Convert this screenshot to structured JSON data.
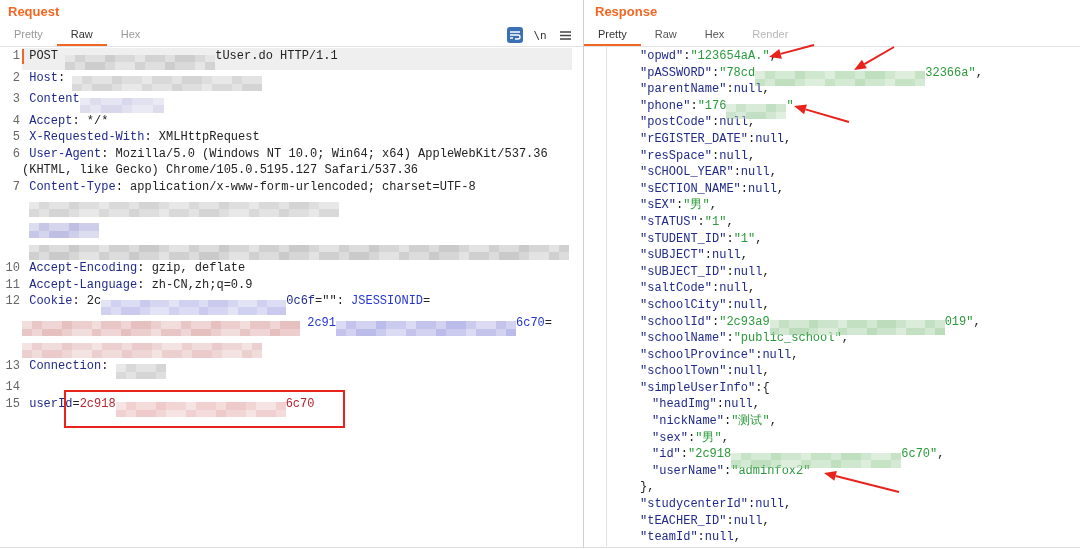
{
  "request": {
    "title": "Request",
    "tabs": [
      {
        "label": "Pretty",
        "selected": false
      },
      {
        "label": "Raw",
        "selected": true
      },
      {
        "label": "Hex",
        "selected": false
      }
    ],
    "toolbar": [
      {
        "kind": "wrap",
        "on": true
      },
      {
        "kind": "newline",
        "label": "\\n",
        "on": false
      },
      {
        "kind": "menu"
      }
    ],
    "lines": [
      {
        "number": "1",
        "current": true,
        "boxed": false,
        "segments": [
          {
            "kind": "text",
            "text": "POST "
          },
          {
            "kind": "redacted",
            "color": "#c8c8c8"
          },
          {
            "kind": "text",
            "text": "tUser.do HTTP/1.1"
          }
        ]
      },
      {
        "number": "2",
        "current": false,
        "boxed": false,
        "segments": [
          {
            "kind": "name",
            "text": "Host"
          },
          {
            "kind": "text",
            "text": ": "
          },
          {
            "kind": "redacted",
            "color": "#cfcfcf"
          }
        ]
      },
      {
        "number": "3",
        "current": false,
        "boxed": false,
        "segments": [
          {
            "kind": "name",
            "text": "Content"
          },
          {
            "kind": "redacted",
            "color": "#d4d4ea"
          }
        ]
      },
      {
        "number": "4",
        "current": false,
        "boxed": false,
        "segments": [
          {
            "kind": "name",
            "text": "Accept"
          },
          {
            "kind": "text",
            "text": ": */*"
          }
        ]
      },
      {
        "number": "5",
        "current": false,
        "boxed": false,
        "segments": [
          {
            "kind": "name",
            "text": "X-Requested-With"
          },
          {
            "kind": "text",
            "text": ": XMLHttpRequest"
          }
        ]
      },
      {
        "number": "6",
        "current": false,
        "boxed": false,
        "segments": [
          {
            "kind": "name",
            "text": "User-Agent"
          },
          {
            "kind": "text",
            "text": ": Mozilla/5.0 (Windows NT 10.0; Win64; x64) AppleWebKit/537.36"
          },
          {
            "kind": "break"
          },
          {
            "kind": "text",
            "text": "(KHTML, like Gecko) Chrome/105.0.5195.127 Safari/537.36"
          }
        ]
      },
      {
        "number": "7",
        "current": false,
        "boxed": false,
        "segments": [
          {
            "kind": "name",
            "text": "Content-Type"
          },
          {
            "kind": "text",
            "text": ": application/x-www-form-urlencoded; charset=UTF-8"
          }
        ]
      },
      {
        "current": false,
        "boxed": false,
        "segments": [
          {
            "kind": "redacted",
            "color": "#cfcfcf"
          }
        ]
      },
      {
        "current": false,
        "boxed": false,
        "segments": [
          {
            "kind": "redacted",
            "color": "#b8b8e0"
          }
        ]
      },
      {
        "current": false,
        "boxed": false,
        "segments": [
          {
            "kind": "redacted",
            "color": "#c4c4c4"
          }
        ]
      },
      {
        "number": "10",
        "current": false,
        "boxed": false,
        "segments": [
          {
            "kind": "name",
            "text": "Accept-Encoding"
          },
          {
            "kind": "text",
            "text": ": gzip, deflate"
          }
        ]
      },
      {
        "number": "11",
        "current": false,
        "boxed": false,
        "segments": [
          {
            "kind": "name",
            "text": "Accept-Language"
          },
          {
            "kind": "text",
            "text": ": zh-CN,zh;q=0.9"
          }
        ]
      },
      {
        "number": "12",
        "current": false,
        "boxed": false,
        "segments": [
          {
            "kind": "name",
            "text": "Cookie"
          },
          {
            "kind": "text",
            "text": ": 2c"
          },
          {
            "kind": "redacted",
            "color": "#c4c4ec"
          },
          {
            "kind": "name",
            "text": "0c6f"
          },
          {
            "kind": "text",
            "text": "=\"\": "
          },
          {
            "kind": "cookie",
            "text": "JSESSIONID"
          },
          {
            "kind": "text",
            "text": "="
          },
          {
            "kind": "break"
          },
          {
            "kind": "redacted",
            "color": "#e4b8b8"
          },
          {
            "kind": "cookie",
            "text": " 2c91"
          },
          {
            "kind": "redacted",
            "color": "#b4b4e8"
          },
          {
            "kind": "cookie",
            "text": "6c70"
          },
          {
            "kind": "text",
            "text": "="
          },
          {
            "kind": "break"
          },
          {
            "kind": "redacted",
            "color": "#e8c4c4"
          }
        ]
      },
      {
        "number": "13",
        "current": false,
        "boxed": false,
        "segments": [
          {
            "kind": "name",
            "text": "Connection"
          },
          {
            "kind": "text",
            "text": ": "
          },
          {
            "kind": "redacted",
            "color": "#d0d0d0"
          }
        ]
      },
      {
        "number": "14",
        "current": false,
        "boxed": false
      },
      {
        "number": "15",
        "current": false,
        "boxed": true,
        "segments": [
          {
            "kind": "name",
            "text": "userId"
          },
          {
            "kind": "text",
            "text": "="
          },
          {
            "kind": "value",
            "text": "2c918"
          },
          {
            "kind": "redacted",
            "color": "#ecc4c4"
          },
          {
            "kind": "value",
            "text": "6c70"
          }
        ]
      }
    ]
  },
  "response": {
    "title": "Response",
    "tabs": [
      {
        "label": "Pretty",
        "selected": true,
        "disabled": false
      },
      {
        "label": "Raw",
        "selected": false,
        "disabled": false
      },
      {
        "label": "Hex",
        "selected": false,
        "disabled": false
      },
      {
        "label": "Render",
        "selected": false,
        "disabled": true
      }
    ],
    "lines": [
      {
        "arrow": true,
        "segments": [
          {
            "kind": "key",
            "text": "\"opwd\""
          },
          {
            "kind": "punct",
            "text": ":"
          },
          {
            "kind": "string",
            "text": "\"123654aA.\""
          },
          {
            "kind": "punct",
            "text": ","
          }
        ]
      },
      {
        "arrow": true,
        "segments": [
          {
            "kind": "key",
            "text": "\"pASSWORD\""
          },
          {
            "kind": "punct",
            "text": ":"
          },
          {
            "kind": "string",
            "text": "\"78cd"
          },
          {
            "kind": "redacted",
            "color": "#b8dcb8"
          },
          {
            "kind": "string",
            "text": "32366a\""
          },
          {
            "kind": "punct",
            "text": ","
          }
        ]
      },
      {
        "arrow": false,
        "segments": [
          {
            "kind": "key",
            "text": "\"parentName\""
          },
          {
            "kind": "punct",
            "text": ":"
          },
          {
            "kind": "null",
            "text": "null"
          },
          {
            "kind": "punct",
            "text": ","
          }
        ]
      },
      {
        "arrow": true,
        "segments": [
          {
            "kind": "key",
            "text": "\"phone\""
          },
          {
            "kind": "punct",
            "text": ":"
          },
          {
            "kind": "string",
            "text": "\"176"
          },
          {
            "kind": "redacted",
            "color": "#bcdcbc"
          },
          {
            "kind": "string",
            "text": "\""
          }
        ]
      },
      {
        "arrow": false,
        "segments": [
          {
            "kind": "key",
            "text": "\"postCode\""
          },
          {
            "kind": "punct",
            "text": ":"
          },
          {
            "kind": "null",
            "text": "null"
          },
          {
            "kind": "punct",
            "text": ","
          }
        ]
      },
      {
        "arrow": false,
        "segments": [
          {
            "kind": "key",
            "text": "\"rEGISTER_DATE\""
          },
          {
            "kind": "punct",
            "text": ":"
          },
          {
            "kind": "null",
            "text": "null"
          },
          {
            "kind": "punct",
            "text": ","
          }
        ]
      },
      {
        "arrow": false,
        "segments": [
          {
            "kind": "key",
            "text": "\"resSpace\""
          },
          {
            "kind": "punct",
            "text": ":"
          },
          {
            "kind": "null",
            "text": "null"
          },
          {
            "kind": "punct",
            "text": ","
          }
        ]
      },
      {
        "arrow": false,
        "segments": [
          {
            "kind": "key",
            "text": "\"sCHOOL_YEAR\""
          },
          {
            "kind": "punct",
            "text": ":"
          },
          {
            "kind": "null",
            "text": "null"
          },
          {
            "kind": "punct",
            "text": ","
          }
        ]
      },
      {
        "arrow": false,
        "segments": [
          {
            "kind": "key",
            "text": "\"sECTION_NAME\""
          },
          {
            "kind": "punct",
            "text": ":"
          },
          {
            "kind": "null",
            "text": "null"
          },
          {
            "kind": "punct",
            "text": ","
          }
        ]
      },
      {
        "arrow": false,
        "segments": [
          {
            "kind": "key",
            "text": "\"sEX\""
          },
          {
            "kind": "punct",
            "text": ":"
          },
          {
            "kind": "string",
            "text": "\"男\""
          },
          {
            "kind": "punct",
            "text": ","
          }
        ]
      },
      {
        "arrow": false,
        "segments": [
          {
            "kind": "key",
            "text": "\"sTATUS\""
          },
          {
            "kind": "punct",
            "text": ":"
          },
          {
            "kind": "string",
            "text": "\"1\""
          },
          {
            "kind": "punct",
            "text": ","
          }
        ]
      },
      {
        "arrow": false,
        "segments": [
          {
            "kind": "key",
            "text": "\"sTUDENT_ID\""
          },
          {
            "kind": "punct",
            "text": ":"
          },
          {
            "kind": "string",
            "text": "\"1\""
          },
          {
            "kind": "punct",
            "text": ","
          }
        ]
      },
      {
        "arrow": false,
        "segments": [
          {
            "kind": "key",
            "text": "\"sUBJECT\""
          },
          {
            "kind": "punct",
            "text": ":"
          },
          {
            "kind": "null",
            "text": "null"
          },
          {
            "kind": "punct",
            "text": ","
          }
        ]
      },
      {
        "arrow": false,
        "segments": [
          {
            "kind": "key",
            "text": "\"sUBJECT_ID\""
          },
          {
            "kind": "punct",
            "text": ":"
          },
          {
            "kind": "null",
            "text": "null"
          },
          {
            "kind": "punct",
            "text": ","
          }
        ]
      },
      {
        "arrow": false,
        "segments": [
          {
            "kind": "key",
            "text": "\"saltCode\""
          },
          {
            "kind": "punct",
            "text": ":"
          },
          {
            "kind": "null",
            "text": "null"
          },
          {
            "kind": "punct",
            "text": ","
          }
        ]
      },
      {
        "arrow": false,
        "segments": [
          {
            "kind": "key",
            "text": "\"schoolCity\""
          },
          {
            "kind": "punct",
            "text": ":"
          },
          {
            "kind": "null",
            "text": "null"
          },
          {
            "kind": "punct",
            "text": ","
          }
        ]
      },
      {
        "arrow": false,
        "segments": [
          {
            "kind": "key",
            "text": "\"schoolId\""
          },
          {
            "kind": "punct",
            "text": ":"
          },
          {
            "kind": "string",
            "text": "\"2c93a9"
          },
          {
            "kind": "redacted",
            "color": "#b4d8b4"
          },
          {
            "kind": "string",
            "text": "019\""
          },
          {
            "kind": "punct",
            "text": ","
          }
        ]
      },
      {
        "arrow": false,
        "segments": [
          {
            "kind": "key",
            "text": "\"schoolName\""
          },
          {
            "kind": "punct",
            "text": ":"
          },
          {
            "kind": "string",
            "text": "\"public_school\""
          },
          {
            "kind": "punct",
            "text": ","
          }
        ]
      },
      {
        "arrow": false,
        "segments": [
          {
            "kind": "key",
            "text": "\"schoolProvince\""
          },
          {
            "kind": "punct",
            "text": ":"
          },
          {
            "kind": "null",
            "text": "null"
          },
          {
            "kind": "punct",
            "text": ","
          }
        ]
      },
      {
        "arrow": false,
        "segments": [
          {
            "kind": "key",
            "text": "\"schoolTown\""
          },
          {
            "kind": "punct",
            "text": ":"
          },
          {
            "kind": "null",
            "text": "null"
          },
          {
            "kind": "punct",
            "text": ","
          }
        ]
      },
      {
        "arrow": false,
        "segments": [
          {
            "kind": "key",
            "text": "\"simpleUserInfo\""
          },
          {
            "kind": "punct",
            "text": ":{"
          }
        ],
        "close": [
          {
            "kind": "punct",
            "text": "},"
          }
        ],
        "children": [
          {
            "arrow": false,
            "segments": [
              {
                "kind": "key",
                "text": "\"headImg\""
              },
              {
                "kind": "punct",
                "text": ":"
              },
              {
                "kind": "null",
                "text": "null"
              },
              {
                "kind": "punct",
                "text": ","
              }
            ]
          },
          {
            "arrow": false,
            "segments": [
              {
                "kind": "key",
                "text": "\"nickName\""
              },
              {
                "kind": "punct",
                "text": ":"
              },
              {
                "kind": "string",
                "text": "\"测试\""
              },
              {
                "kind": "punct",
                "text": ","
              }
            ]
          },
          {
            "arrow": false,
            "segments": [
              {
                "kind": "key",
                "text": "\"sex\""
              },
              {
                "kind": "punct",
                "text": ":"
              },
              {
                "kind": "string",
                "text": "\"男\""
              },
              {
                "kind": "punct",
                "text": ","
              }
            ]
          },
          {
            "arrow": false,
            "segments": [
              {
                "kind": "key",
                "text": "\"id\""
              },
              {
                "kind": "punct",
                "text": ":"
              },
              {
                "kind": "string",
                "text": "\"2c918"
              },
              {
                "kind": "redacted",
                "color": "#b8dcb8"
              },
              {
                "kind": "string",
                "text": "6c70\""
              },
              {
                "kind": "punct",
                "text": ","
              }
            ]
          },
          {
            "arrow": true,
            "segments": [
              {
                "kind": "key",
                "text": "\"userName\""
              },
              {
                "kind": "punct",
                "text": ":"
              },
              {
                "kind": "string",
                "text": "\"adminfox2\""
              }
            ]
          }
        ]
      },
      {
        "arrow": false,
        "segments": [
          {
            "kind": "key",
            "text": "\"studycenterId\""
          },
          {
            "kind": "punct",
            "text": ":"
          },
          {
            "kind": "null",
            "text": "null"
          },
          {
            "kind": "punct",
            "text": ","
          }
        ]
      },
      {
        "arrow": false,
        "segments": [
          {
            "kind": "key",
            "text": "\"tEACHER_ID\""
          },
          {
            "kind": "punct",
            "text": ":"
          },
          {
            "kind": "null",
            "text": "null"
          },
          {
            "kind": "punct",
            "text": ","
          }
        ]
      },
      {
        "arrow": false,
        "segments": [
          {
            "kind": "key",
            "text": "\"teamId\""
          },
          {
            "kind": "punct",
            "text": ":"
          },
          {
            "kind": "null",
            "text": "null"
          },
          {
            "kind": "punct",
            "text": ","
          }
        ]
      }
    ]
  }
}
